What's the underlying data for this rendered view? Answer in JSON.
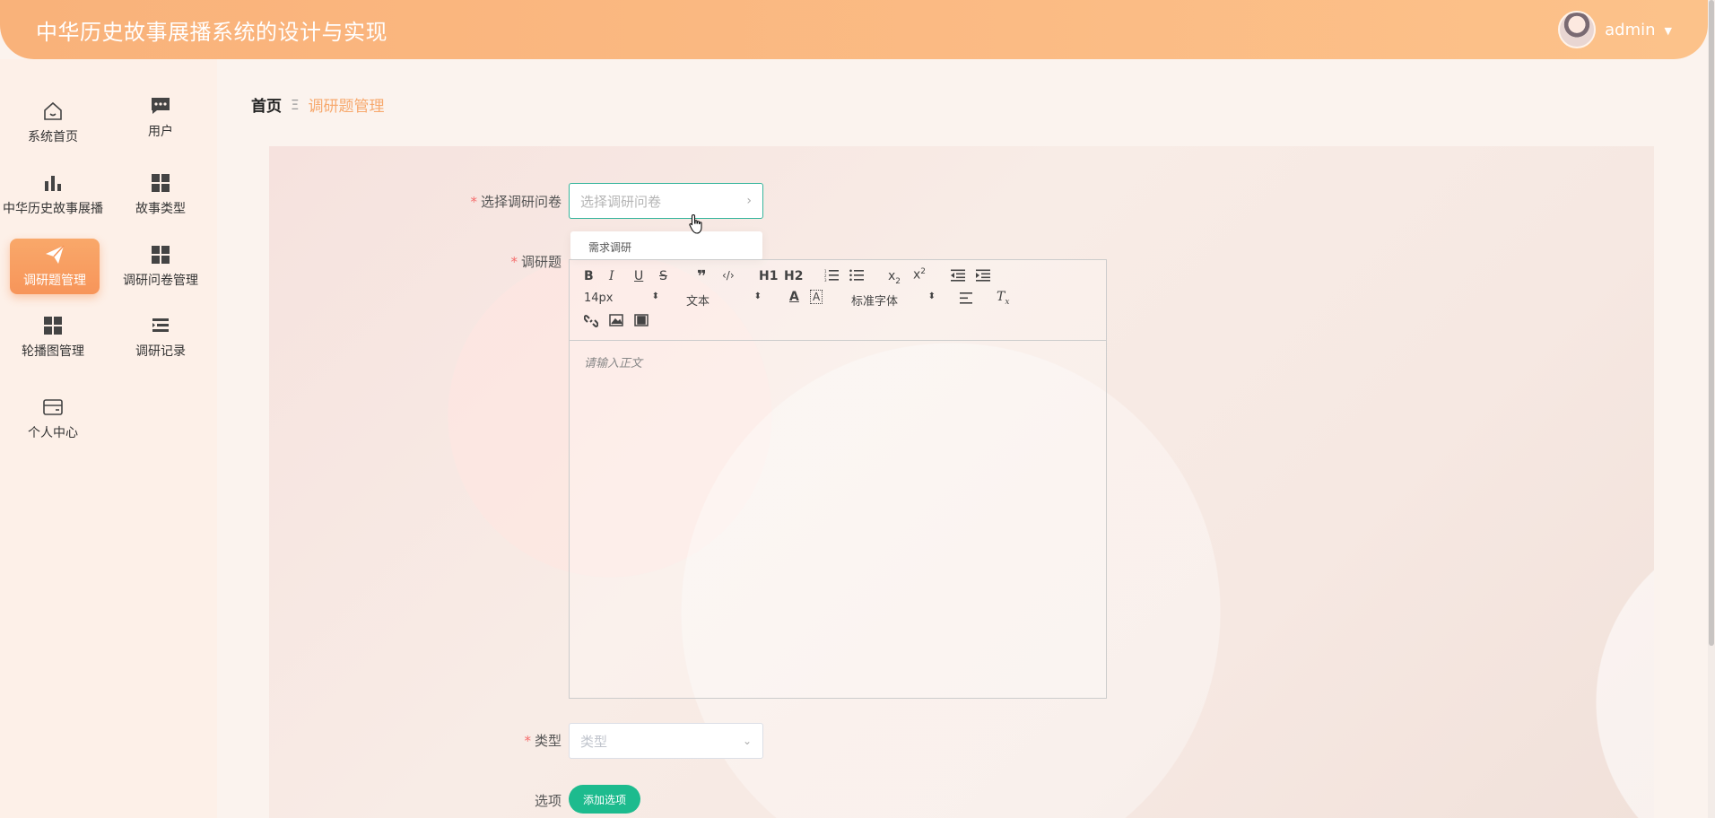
{
  "header": {
    "title": "中华历史故事展播系统的设计与实现",
    "username": "admin"
  },
  "sidebar": {
    "items": [
      {
        "label": "系统首页",
        "icon": "home-icon"
      },
      {
        "label": "用户",
        "icon": "chat-icon"
      },
      {
        "label": "中华历史故事展播",
        "icon": "bar-chart-icon"
      },
      {
        "label": "故事类型",
        "icon": "grid-icon"
      },
      {
        "label": "调研题管理",
        "icon": "send-icon",
        "active": true
      },
      {
        "label": "调研问卷管理",
        "icon": "grid-icon"
      },
      {
        "label": "轮播图管理",
        "icon": "grid-icon"
      },
      {
        "label": "调研记录",
        "icon": "list-indent-icon"
      },
      {
        "label": "个人中心",
        "icon": "wallet-icon"
      }
    ]
  },
  "breadcrumb": {
    "home": "首页",
    "separator": "Ξ",
    "current": "调研题管理"
  },
  "form": {
    "questionnaire_label": "选择调研问卷",
    "questionnaire_placeholder": "选择调研问卷",
    "dropdown_option": "需求调研",
    "question_label": "调研题",
    "editor_placeholder": "请输入正文",
    "type_label": "类型",
    "type_placeholder": "类型",
    "options_label": "选项",
    "add_option_button": "添加选项"
  },
  "toolbar": {
    "font_size": "14px",
    "block_format": "文本",
    "font_family": "标准字体",
    "h1": "H1",
    "h2": "H2"
  },
  "colors": {
    "header": "#fbb880",
    "accent": "#f7a96e",
    "active_nav": "#f79c5f",
    "primary_green": "#1dbb8e",
    "focus_border": "#36b59c"
  }
}
